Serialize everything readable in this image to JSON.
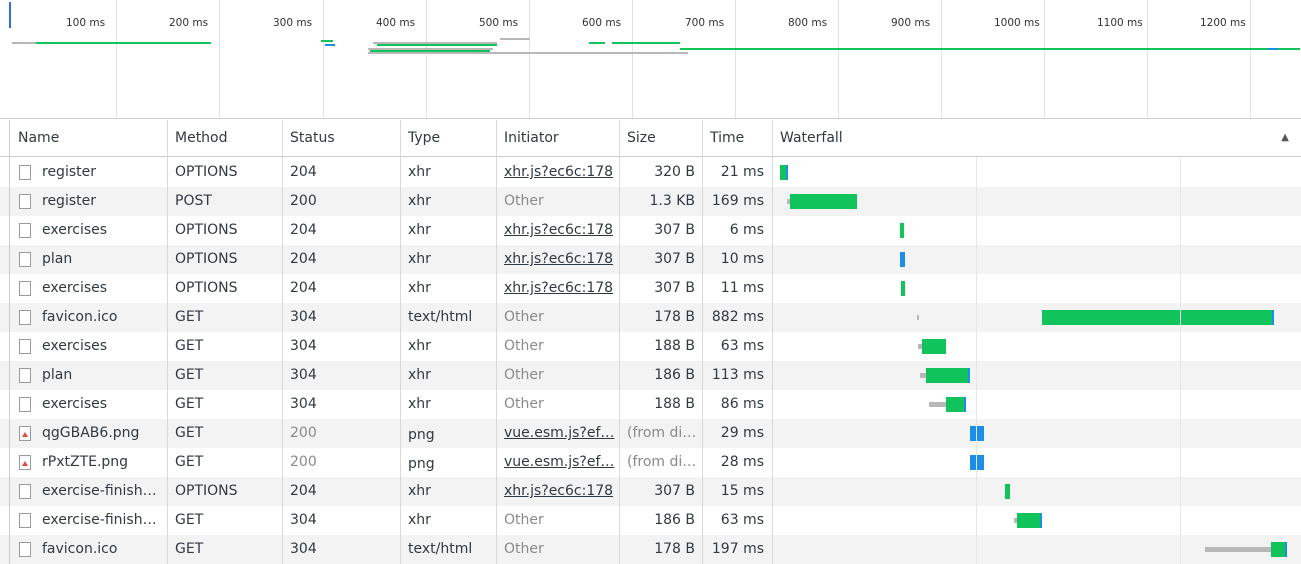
{
  "overview": {
    "ticks": [
      "100 ms",
      "200 ms",
      "300 ms",
      "400 ms",
      "500 ms",
      "600 ms",
      "700 ms",
      "800 ms",
      "900 ms",
      "1000 ms",
      "1100 ms",
      "1200 ms"
    ]
  },
  "columns": {
    "name": "Name",
    "method": "Method",
    "status": "Status",
    "type": "Type",
    "initiator": "Initiator",
    "size": "Size",
    "time": "Time",
    "waterfall": "Waterfall"
  },
  "rows": [
    {
      "name": "register",
      "method": "OPTIONS",
      "status": "204",
      "type": "xhr",
      "initiator": "xhr.js?ec6c:178",
      "size": "320 B",
      "time": "21 ms",
      "icon": "file-icon"
    },
    {
      "name": "register",
      "method": "POST",
      "status": "200",
      "type": "xhr",
      "initiator": "Other",
      "size": "1.3 KB",
      "time": "169 ms",
      "icon": "file-icon"
    },
    {
      "name": "exercises",
      "method": "OPTIONS",
      "status": "204",
      "type": "xhr",
      "initiator": "xhr.js?ec6c:178",
      "size": "307 B",
      "time": "6 ms",
      "icon": "file-icon"
    },
    {
      "name": "plan",
      "method": "OPTIONS",
      "status": "204",
      "type": "xhr",
      "initiator": "xhr.js?ec6c:178",
      "size": "307 B",
      "time": "10 ms",
      "icon": "file-icon"
    },
    {
      "name": "exercises",
      "method": "OPTIONS",
      "status": "204",
      "type": "xhr",
      "initiator": "xhr.js?ec6c:178",
      "size": "307 B",
      "time": "11 ms",
      "icon": "file-icon"
    },
    {
      "name": "favicon.ico",
      "method": "GET",
      "status": "304",
      "type": "text/html",
      "initiator": "Other",
      "size": "178 B",
      "time": "882 ms",
      "icon": "file-icon"
    },
    {
      "name": "exercises",
      "method": "GET",
      "status": "304",
      "type": "xhr",
      "initiator": "Other",
      "size": "188 B",
      "time": "63 ms",
      "icon": "file-icon"
    },
    {
      "name": "plan",
      "method": "GET",
      "status": "304",
      "type": "xhr",
      "initiator": "Other",
      "size": "186 B",
      "time": "113 ms",
      "icon": "file-icon"
    },
    {
      "name": "exercises",
      "method": "GET",
      "status": "304",
      "type": "xhr",
      "initiator": "Other",
      "size": "188 B",
      "time": "86 ms",
      "icon": "file-icon"
    },
    {
      "name": "qgGBAB6.png",
      "method": "GET",
      "status": "200",
      "type": "png",
      "initiator": "vue.esm.js?ef…",
      "size": "(from di…",
      "time": "29 ms",
      "icon": "image-icon"
    },
    {
      "name": "rPxtZTE.png",
      "method": "GET",
      "status": "200",
      "type": "png",
      "initiator": "vue.esm.js?ef…",
      "size": "(from di…",
      "time": "28 ms",
      "icon": "image-icon"
    },
    {
      "name": "exercise-finish…",
      "method": "OPTIONS",
      "status": "204",
      "type": "xhr",
      "initiator": "xhr.js?ec6c:178",
      "size": "307 B",
      "time": "15 ms",
      "icon": "file-icon"
    },
    {
      "name": "exercise-finish…",
      "method": "GET",
      "status": "304",
      "type": "xhr",
      "initiator": "Other",
      "size": "186 B",
      "time": "63 ms",
      "icon": "file-icon"
    },
    {
      "name": "favicon.ico",
      "method": "GET",
      "status": "304",
      "type": "text/html",
      "initiator": "Other",
      "size": "178 B",
      "time": "197 ms",
      "icon": "file-icon"
    }
  ],
  "colors": {
    "download": "#10c35a",
    "cached": "#1d8ee8",
    "wait": "#b8b8b8"
  }
}
